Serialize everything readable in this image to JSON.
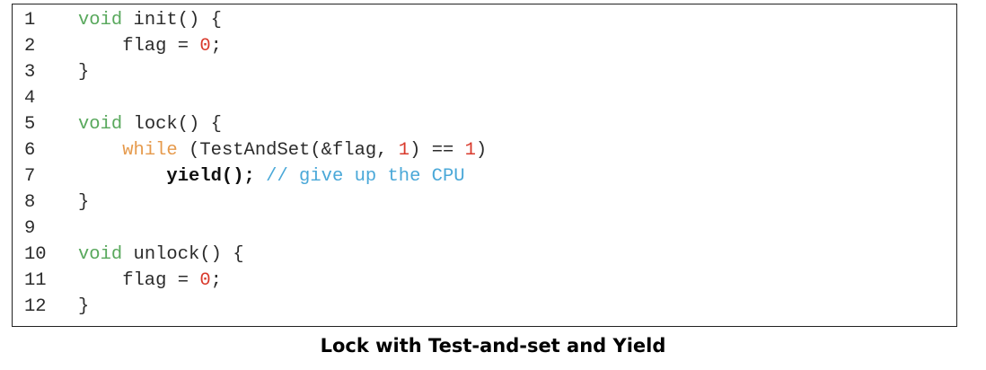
{
  "code": {
    "line_numbers": [
      "1",
      "2",
      "3",
      "4",
      "5",
      "6",
      "7",
      "8",
      "9",
      "10",
      "11",
      "12"
    ],
    "lines": [
      [
        {
          "t": "void",
          "c": "kw"
        },
        {
          "t": " init() {",
          "c": ""
        }
      ],
      [
        {
          "t": "    flag = ",
          "c": ""
        },
        {
          "t": "0",
          "c": "num"
        },
        {
          "t": ";",
          "c": ""
        }
      ],
      [
        {
          "t": "}",
          "c": ""
        }
      ],
      [],
      [
        {
          "t": "void",
          "c": "kw"
        },
        {
          "t": " lock() {",
          "c": ""
        }
      ],
      [
        {
          "t": "    ",
          "c": ""
        },
        {
          "t": "while",
          "c": "kw-while"
        },
        {
          "t": " (TestAndSet(&flag, ",
          "c": ""
        },
        {
          "t": "1",
          "c": "num"
        },
        {
          "t": ") == ",
          "c": ""
        },
        {
          "t": "1",
          "c": "num"
        },
        {
          "t": ")",
          "c": ""
        }
      ],
      [
        {
          "t": "        ",
          "c": ""
        },
        {
          "t": "yield();",
          "c": "bold"
        },
        {
          "t": " ",
          "c": ""
        },
        {
          "t": "// give up the CPU",
          "c": "cm"
        }
      ],
      [
        {
          "t": "}",
          "c": ""
        }
      ],
      [],
      [
        {
          "t": "void",
          "c": "kw"
        },
        {
          "t": " unlock() {",
          "c": ""
        }
      ],
      [
        {
          "t": "    flag = ",
          "c": ""
        },
        {
          "t": "0",
          "c": "num"
        },
        {
          "t": ";",
          "c": ""
        }
      ],
      [
        {
          "t": "}",
          "c": ""
        }
      ]
    ]
  },
  "caption": "Lock with Test-and-set and Yield",
  "colors": {
    "keyword": "#58a85c",
    "while_keyword": "#e69a4c",
    "number": "#d93a2c",
    "comment": "#4aa8d8",
    "text": "#2b2b2b"
  }
}
